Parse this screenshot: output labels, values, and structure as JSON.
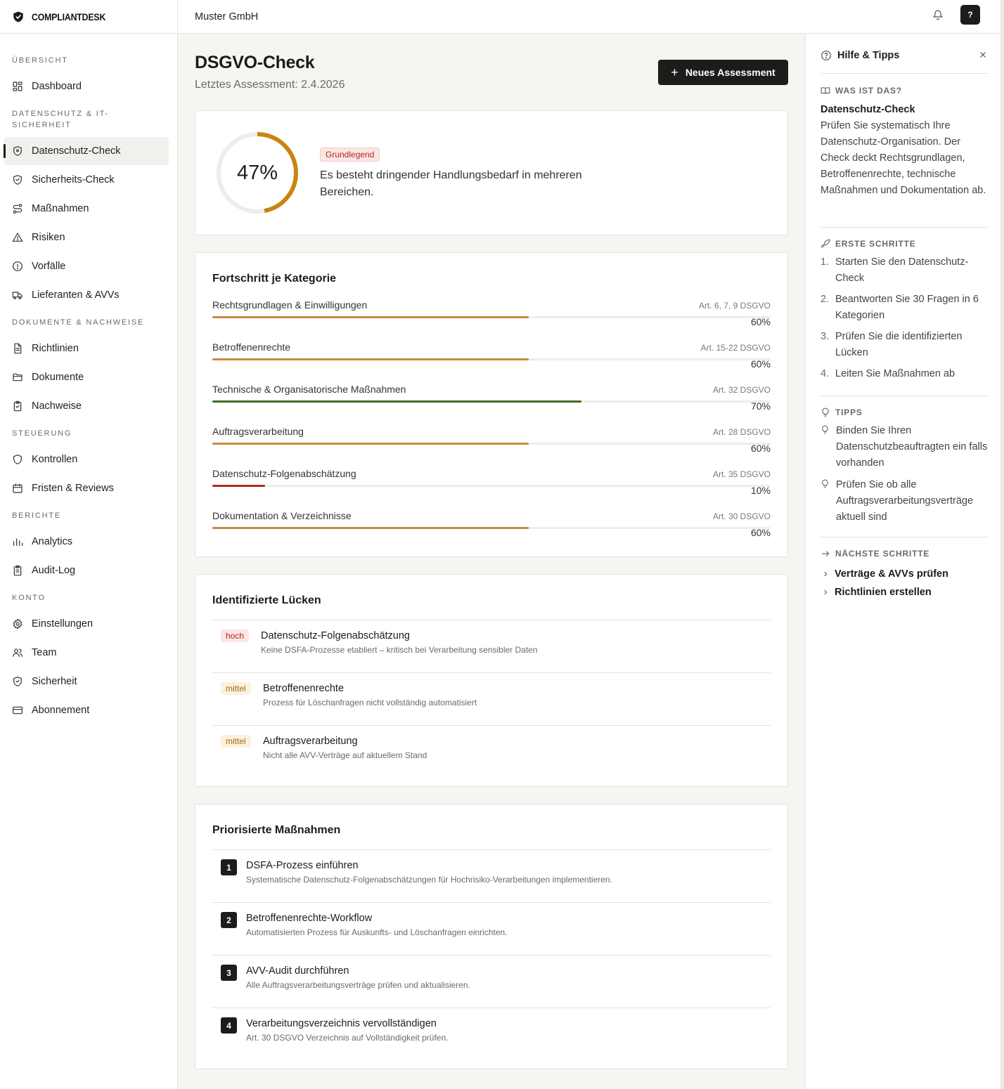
{
  "brand": {
    "name": "COMPLIANTDESK"
  },
  "topbar": {
    "org": "Muster GmbH",
    "help_label": "?"
  },
  "sidebar": {
    "sections": [
      {
        "label": "ÜBERSICHT",
        "items": [
          {
            "label": "Dashboard",
            "icon": "dashboard-icon"
          }
        ]
      },
      {
        "label": "DATENSCHUTZ & IT-SICHERHEIT",
        "items": [
          {
            "label": "Datenschutz-Check",
            "icon": "shield-icon",
            "active": true
          },
          {
            "label": "Sicherheits-Check",
            "icon": "shield-check-icon"
          },
          {
            "label": "Maßnahmen",
            "icon": "route-icon"
          },
          {
            "label": "Risiken",
            "icon": "warning-icon"
          },
          {
            "label": "Vorfälle",
            "icon": "alert-circle-icon"
          },
          {
            "label": "Lieferanten & AVVs",
            "icon": "truck-icon"
          }
        ]
      },
      {
        "label": "DOKUMENTE & NACHWEISE",
        "items": [
          {
            "label": "Richtlinien",
            "icon": "file-text-icon"
          },
          {
            "label": "Dokumente",
            "icon": "folder-icon"
          },
          {
            "label": "Nachweise",
            "icon": "clipboard-check-icon"
          }
        ]
      },
      {
        "label": "STEUERUNG",
        "items": [
          {
            "label": "Kontrollen",
            "icon": "shield-outline-icon"
          },
          {
            "label": "Fristen & Reviews",
            "icon": "calendar-icon"
          }
        ]
      },
      {
        "label": "BERICHTE",
        "items": [
          {
            "label": "Analytics",
            "icon": "bar-chart-icon"
          },
          {
            "label": "Audit-Log",
            "icon": "clipboard-list-icon"
          }
        ]
      },
      {
        "label": "KONTO",
        "items": [
          {
            "label": "Einstellungen",
            "icon": "gear-icon"
          },
          {
            "label": "Team",
            "icon": "users-icon"
          },
          {
            "label": "Sicherheit",
            "icon": "shield-check-icon"
          },
          {
            "label": "Abonnement",
            "icon": "credit-card-icon"
          }
        ]
      }
    ]
  },
  "page": {
    "title": "DSGVO-Check",
    "subtitle": "Letztes Assessment: 2.4.2026",
    "new_button": "Neues Assessment"
  },
  "score": {
    "value": 47,
    "value_label": "47%",
    "badge": "Grundlegend",
    "text": "Es besteht dringender Handlungsbedarf in mehreren Bereichen.",
    "color": "#c9850f"
  },
  "progress": {
    "title": "Fortschritt je Kategorie",
    "categories": [
      {
        "name": "Rechtsgrundlagen & Einwilligungen",
        "article": "Art. 6, 7, 9 DSGVO",
        "percent": 60,
        "label": "60%",
        "color": "#c98a3e"
      },
      {
        "name": "Betroffenenrechte",
        "article": "Art. 15-22 DSGVO",
        "percent": 60,
        "label": "60%",
        "color": "#c98a3e"
      },
      {
        "name": "Technische & Organisatorische Maßnahmen",
        "article": "Art. 32 DSGVO",
        "percent": 70,
        "label": "70%",
        "color": "#3f6b1f"
      },
      {
        "name": "Auftragsverarbeitung",
        "article": "Art. 28 DSGVO",
        "percent": 60,
        "label": "60%",
        "color": "#c98a3e"
      },
      {
        "name": "Datenschutz-Folgenabschätzung",
        "article": "Art. 35 DSGVO",
        "percent": 10,
        "label": "10%",
        "color": "#b3261e"
      },
      {
        "name": "Dokumentation & Verzeichnisse",
        "article": "Art. 30 DSGVO",
        "percent": 60,
        "label": "60%",
        "color": "#c98a3e"
      }
    ]
  },
  "gaps": {
    "title": "Identifizierte Lücken",
    "items": [
      {
        "severity": "hoch",
        "title": "Datenschutz-Folgenabschätzung",
        "desc": "Keine DSFA-Prozesse etabliert – kritisch bei Verarbeitung sensibler Daten"
      },
      {
        "severity": "mittel",
        "title": "Betroffenenrechte",
        "desc": "Prozess für Löschanfragen nicht vollständig automatisiert"
      },
      {
        "severity": "mittel",
        "title": "Auftragsverarbeitung",
        "desc": "Nicht alle AVV-Verträge auf aktuellem Stand"
      }
    ]
  },
  "actions": {
    "title": "Priorisierte Maßnahmen",
    "items": [
      {
        "num": "1",
        "title": "DSFA-Prozess einführen",
        "desc": "Systematische Datenschutz-Folgenabschätzungen für Hochrisiko-Verarbeitungen implementieren."
      },
      {
        "num": "2",
        "title": "Betroffenenrechte-Workflow",
        "desc": "Automatisierten Prozess für Auskunfts- und Löschanfragen einrichten."
      },
      {
        "num": "3",
        "title": "AVV-Audit durchführen",
        "desc": "Alle Auftragsverarbeitungsverträge prüfen und aktualisieren."
      },
      {
        "num": "4",
        "title": "Verarbeitungsverzeichnis vervollständigen",
        "desc": "Art. 30 DSGVO Verzeichnis auf Vollständigkeit prüfen."
      }
    ]
  },
  "help": {
    "title": "Hilfe & Tipps",
    "what_label": "WAS IST DAS?",
    "what_title": "Datenschutz-Check",
    "what_text": "Prüfen Sie systematisch Ihre Datenschutz-Organisation. Der Check deckt Rechtsgrundlagen, Betroffenenrechte, technische Maßnahmen und Dokumentation ab.",
    "steps_label": "ERSTE SCHRITTE",
    "steps": [
      {
        "n": "1.",
        "text": "Starten Sie den Datenschutz-Check"
      },
      {
        "n": "2.",
        "text": "Beantworten Sie 30 Fragen in 6 Kategorien"
      },
      {
        "n": "3.",
        "text": "Prüfen Sie die identifizierten Lücken"
      },
      {
        "n": "4.",
        "text": "Leiten Sie Maßnahmen ab"
      }
    ],
    "tips_label": "TIPPS",
    "tips": [
      "Binden Sie Ihren Datenschutzbeauftragten ein falls vorhanden",
      "Prüfen Sie ob alle Auftragsverarbeitungsverträge aktuell sind"
    ],
    "next_label": "NÄCHSTE SCHRITTE",
    "next": [
      "Verträge & AVVs prüfen",
      "Richtlinien erstellen"
    ]
  }
}
